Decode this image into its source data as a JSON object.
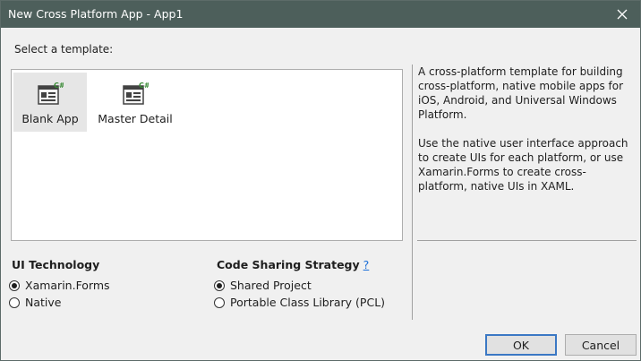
{
  "window": {
    "title": "New Cross Platform App - App1",
    "close_icon": "close-icon"
  },
  "template_section": {
    "label": "Select a template:",
    "templates": [
      {
        "label": "Blank App",
        "icon": "csharp-form-template-icon",
        "selected": true
      },
      {
        "label": "Master Detail",
        "icon": "csharp-master-detail-template-icon",
        "selected": false
      }
    ]
  },
  "description": {
    "paragraphs": [
      "A cross-platform template for building cross-platform, native mobile apps for iOS, Android, and Universal Windows Platform.",
      "Use the native user interface approach to create UIs for each platform, or use Xamarin.Forms to create cross-platform, native UIs in XAML."
    ]
  },
  "ui_technology": {
    "title": "UI Technology",
    "options": [
      {
        "label": "Xamarin.Forms",
        "checked": true
      },
      {
        "label": "Native",
        "checked": false
      }
    ]
  },
  "code_sharing": {
    "title": "Code Sharing Strategy",
    "help_link": "?",
    "options": [
      {
        "label": "Shared Project",
        "checked": true
      },
      {
        "label": "Portable Class Library (PCL)",
        "checked": false
      }
    ]
  },
  "buttons": {
    "ok": "OK",
    "cancel": "Cancel"
  },
  "colors": {
    "titlebar": "#4d5f5b",
    "link": "#1a6ed8",
    "selection": "#e6e6e6"
  }
}
